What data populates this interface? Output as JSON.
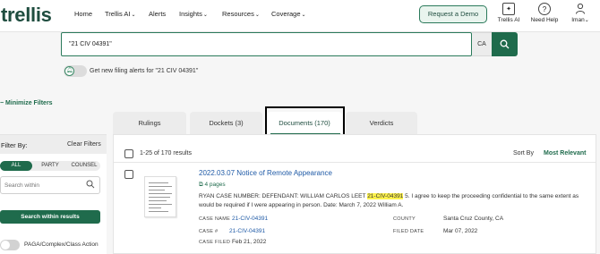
{
  "header": {
    "logo": "trellis",
    "nav": [
      {
        "label": "Home",
        "chevron": false
      },
      {
        "label": "Trellis AI",
        "chevron": true
      },
      {
        "label": "Alerts",
        "chevron": false
      },
      {
        "label": "Insights",
        "chevron": true
      },
      {
        "label": "Resources",
        "chevron": true
      },
      {
        "label": "Coverage",
        "chevron": true
      }
    ],
    "demo_button": "Request a Demo",
    "icons": [
      {
        "name": "trellis-ai-icon",
        "label": "Trellis AI"
      },
      {
        "name": "help-icon",
        "label": "Need Help"
      },
      {
        "name": "user-icon",
        "label": "Iman"
      }
    ],
    "chevron_glyph": "⌄"
  },
  "search": {
    "value": "\"21 CIV 04391\"",
    "state": "CA",
    "alert_text": "Get new filing alerts for \"21 CIV 04391\""
  },
  "minimize_filters": "Minimize Filters",
  "tabs": [
    {
      "label": "Rulings",
      "active": false
    },
    {
      "label": "Dockets (3)",
      "active": false
    },
    {
      "label": "Documents (170)",
      "active": true
    },
    {
      "label": "Verdicts",
      "active": false
    }
  ],
  "sidebar": {
    "filter_by": "Filter By:",
    "clear_filters": "Clear Filters",
    "segments": [
      "ALL",
      "PARTY",
      "COUNSEL"
    ],
    "search_within_placeholder": "Search within",
    "search_within_button": "Search within results",
    "toggle_label": "PAGA/Complex/Class Action"
  },
  "results": {
    "count_text": "1-25 of 170 results",
    "sort_label": "Sort By",
    "sort_value": "Most Relevant",
    "items": [
      {
        "title": "2022.03.07 Notice of Remote Appearance",
        "pages": "4 pages",
        "snippet_pre": "RYAN CASE NUMBER: DEFENDANT: WILLIAM CARLOS LEET ",
        "snippet_hl": "21-CIV-04391",
        "snippet_post": " 5. I agree to keep the proceeding confidential to the same extent as would be required if I were appearing in person. Date: March 7, 2022 William A.",
        "case_name_label": "CASE NAME",
        "case_name": "21-CIV-04391",
        "case_no_label": "CASE #",
        "case_no": "21-CIV-04391",
        "case_filed_label": "CASE FILED",
        "case_filed": "Feb 21, 2022",
        "county_label": "COUNTY",
        "county": "Santa Cruz County, CA",
        "filed_date_label": "FILED DATE",
        "filed_date": "Mar 07, 2022"
      }
    ]
  }
}
